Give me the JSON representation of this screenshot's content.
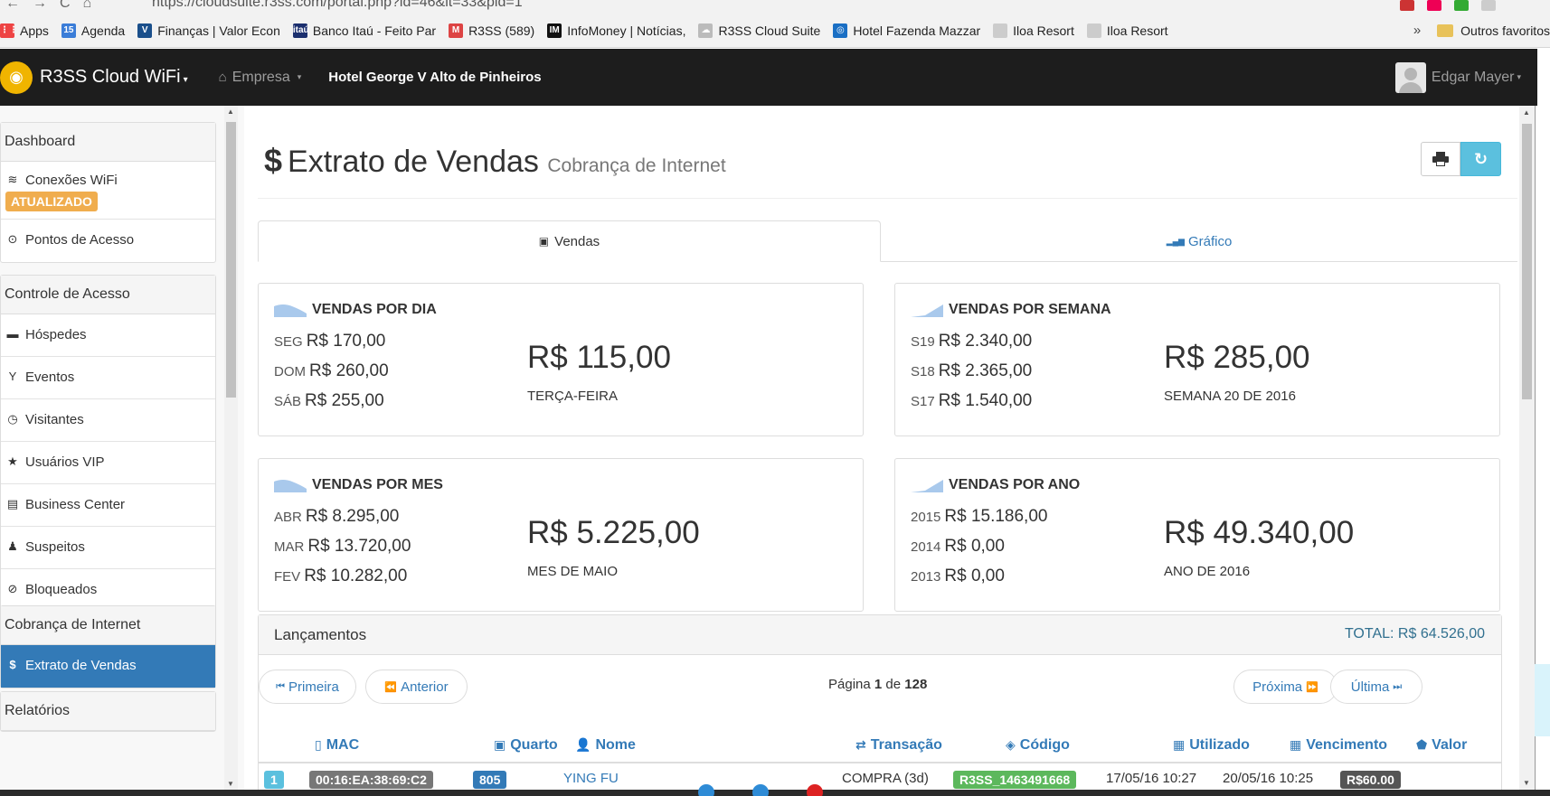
{
  "browser": {
    "url": "https://cloudsuite.r3ss.com/portal.php?id=46&it=33&pid=1",
    "bookmarks": [
      {
        "label": "Apps",
        "fav_color": "#e44",
        "fav_text": "⋮⋮"
      },
      {
        "label": "Agenda",
        "fav_color": "#3b7dd8",
        "fav_text": "15"
      },
      {
        "label": "Finanças | Valor Econ",
        "fav_color": "#1a4f8b",
        "fav_text": "V"
      },
      {
        "label": "Banco Itaú - Feito Par",
        "fav_color": "#1b2f6e",
        "fav_text": "itaú"
      },
      {
        "label": "R3SS (589)",
        "fav_color": "#d44",
        "fav_text": "M"
      },
      {
        "label": "InfoMoney | Notícias,",
        "fav_color": "#111",
        "fav_text": "IM"
      },
      {
        "label": "R3SS Cloud Suite",
        "fav_color": "#bbb",
        "fav_text": "☁"
      },
      {
        "label": "Hotel Fazenda Mazzar",
        "fav_color": "#1a6fc4",
        "fav_text": "◎"
      },
      {
        "label": "Iloa Resort",
        "fav_color": "#ccc",
        "fav_text": ""
      },
      {
        "label": "Iloa Resort",
        "fav_color": "#ccc",
        "fav_text": ""
      }
    ],
    "more_label": "»",
    "other_favorites": "Outros favoritos"
  },
  "navbar": {
    "brand": "R3SS Cloud WiFi",
    "brand_caret": "▾",
    "empresa": "Empresa",
    "hotel": "Hotel George V Alto de Pinheiros",
    "user": "Edgar Mayer"
  },
  "sidebar": {
    "dashboard": {
      "header": "Dashboard",
      "items": [
        {
          "icon": "wifi-icon",
          "glyph": "≋",
          "label": "Conexões WiFi",
          "badge": "ATUALIZADO"
        },
        {
          "icon": "target-icon",
          "glyph": "⊙",
          "label": "Pontos de Acesso"
        }
      ]
    },
    "controle": {
      "header": "Controle de Acesso",
      "items": [
        {
          "icon": "briefcase-icon",
          "glyph": "▬",
          "label": "Hóspedes"
        },
        {
          "icon": "glass-icon",
          "glyph": "Y",
          "label": "Eventos"
        },
        {
          "icon": "clock-icon",
          "glyph": "◷",
          "label": "Visitantes"
        },
        {
          "icon": "star-icon",
          "glyph": "★",
          "label": "Usuários VIP"
        },
        {
          "icon": "building-icon",
          "glyph": "▤",
          "label": "Business Center"
        },
        {
          "icon": "user-secret-icon",
          "glyph": "♟",
          "label": "Suspeitos"
        },
        {
          "icon": "ban-icon",
          "glyph": "⊘",
          "label": "Bloqueados"
        }
      ]
    },
    "cobranca": {
      "header": "Cobrança de Internet",
      "items": [
        {
          "icon": "dollar-icon",
          "glyph": "$",
          "label": "Extrato de Vendas",
          "active": true
        }
      ]
    },
    "relatorios": {
      "header": "Relatórios"
    }
  },
  "main": {
    "title_symbol": "$",
    "title": "Extrato de Vendas",
    "subtitle": "Cobrança de Internet",
    "tabs": [
      {
        "label": "Vendas",
        "glyph": "▣"
      },
      {
        "label": "Gráfico",
        "glyph": "▂▄▆"
      }
    ],
    "stats": [
      {
        "title": "VENDAS POR DIA",
        "rows": [
          {
            "label": "SEG",
            "value": "R$ 170,00"
          },
          {
            "label": "DOM",
            "value": "R$ 260,00"
          },
          {
            "label": "SÁB",
            "value": "R$ 255,00"
          }
        ],
        "big": "R$ 115,00",
        "sub": "TERÇA-FEIRA"
      },
      {
        "title": "VENDAS POR SEMANA",
        "rows": [
          {
            "label": "S19",
            "value": "R$ 2.340,00"
          },
          {
            "label": "S18",
            "value": "R$ 2.365,00"
          },
          {
            "label": "S17",
            "value": "R$ 1.540,00"
          }
        ],
        "big": "R$ 285,00",
        "sub": "SEMANA 20 DE 2016"
      },
      {
        "title": "VENDAS POR MES",
        "rows": [
          {
            "label": "ABR",
            "value": "R$ 8.295,00"
          },
          {
            "label": "MAR",
            "value": "R$ 13.720,00"
          },
          {
            "label": "FEV",
            "value": "R$ 10.282,00"
          }
        ],
        "big": "R$ 5.225,00",
        "sub": "MES DE MAIO"
      },
      {
        "title": "VENDAS POR ANO",
        "rows": [
          {
            "label": "2015",
            "value": "R$ 15.186,00"
          },
          {
            "label": "2014",
            "value": "R$ 0,00"
          },
          {
            "label": "2013",
            "value": "R$ 0,00"
          }
        ],
        "big": "R$ 49.340,00",
        "sub": "ANO DE 2016"
      }
    ],
    "lancamentos": {
      "title": "Lançamentos",
      "total": "TOTAL: R$ 64.526,00",
      "pager": {
        "first": "Primeira",
        "prev": "Anterior",
        "next": "Próxima",
        "last": "Última",
        "page_prefix": "Página",
        "page": "1",
        "page_mid": "de",
        "pages": "128"
      },
      "columns": [
        {
          "label": "MAC",
          "glyph": "▯"
        },
        {
          "label": "Quarto",
          "glyph": "▣"
        },
        {
          "label": "Nome",
          "glyph": "👤"
        },
        {
          "label": "Transação",
          "glyph": "⇄"
        },
        {
          "label": "Código",
          "glyph": "◈"
        },
        {
          "label": "Utilizado",
          "glyph": "▦"
        },
        {
          "label": "Vencimento",
          "glyph": "▦"
        },
        {
          "label": "Valor",
          "glyph": "⬟"
        }
      ],
      "rows": [
        {
          "index": "1",
          "mac": "00:16:EA:38:69:C2",
          "quarto": "805",
          "nome": "YING FU",
          "transacao": "COMPRA (3d)",
          "codigo": "R3SS_1463491668",
          "utilizado": "17/05/16 10:27",
          "vencimento": "20/05/16 10:25",
          "valor": "R$60.00"
        }
      ]
    }
  },
  "colors": {
    "navbar": "#1d1d1d",
    "primary": "#337ab7",
    "info": "#5bc0de",
    "warning": "#f0ad4e",
    "success": "#5cb85c"
  }
}
